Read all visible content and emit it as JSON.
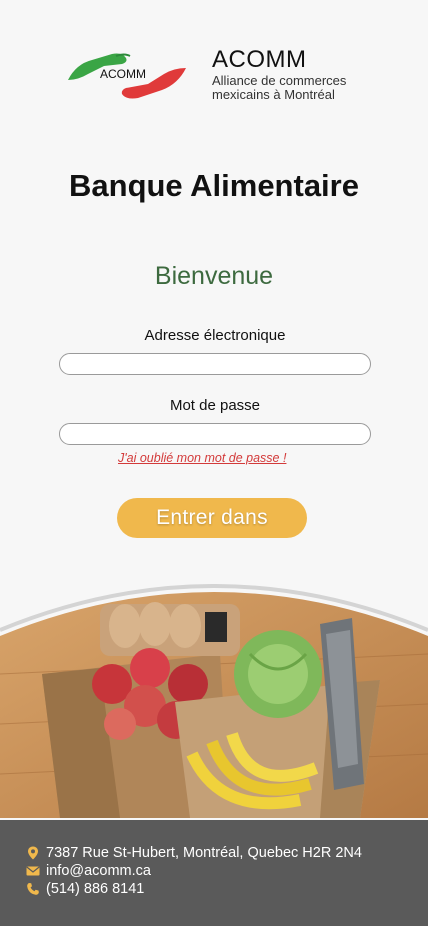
{
  "header": {
    "logo_text": "ACOMM",
    "brand_name": "ACOMM",
    "brand_sub_line1": "Alliance de commerces",
    "brand_sub_line2": "mexicains à Montréal"
  },
  "page_title": "Banque Alimentaire",
  "welcome": "Bienvenue",
  "form": {
    "email_label": "Adresse électronique",
    "email_value": "",
    "password_label": "Mot de passe",
    "password_value": "",
    "forgot_link": "J'ai oublié mon mot de passe !",
    "submit_label": "Entrer dans"
  },
  "footer": {
    "address": "7387 Rue St-Hubert, Montréal, Quebec H2R 2N4",
    "email": "info@acomm.ca",
    "phone": "(514) 886 8141",
    "icons": [
      "map-pin-icon",
      "envelope-icon",
      "phone-icon"
    ]
  },
  "colors": {
    "accent_button": "#f0b84c",
    "welcome_text": "#3d6a3f",
    "forgot_link": "#d33a3a",
    "footer_bg": "#5a5a5a",
    "footer_icons": "#f0b84c",
    "logo_green": "#3aa545",
    "logo_red": "#e03a3a"
  }
}
